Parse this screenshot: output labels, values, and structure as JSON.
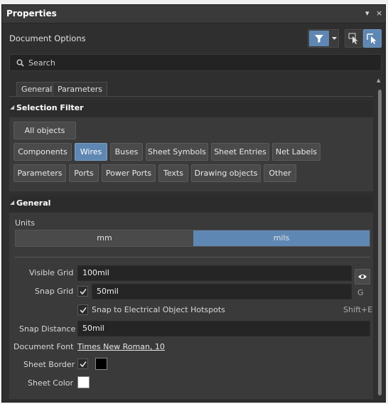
{
  "panel": {
    "title": "Properties",
    "pin_label": "▾",
    "close_label": "×",
    "document_options": "Document Options"
  },
  "search": {
    "placeholder": "Search"
  },
  "tabs": [
    {
      "label": "General",
      "active": true
    },
    {
      "label": "Parameters",
      "active": false
    }
  ],
  "selection_filter": {
    "heading": "Selection Filter",
    "all_objects": "All objects",
    "buttons": [
      {
        "label": "Components",
        "on": false
      },
      {
        "label": "Wires",
        "on": true
      },
      {
        "label": "Buses",
        "on": false
      },
      {
        "label": "Sheet Symbols",
        "on": false
      },
      {
        "label": "Sheet Entries",
        "on": false
      },
      {
        "label": "Net Labels",
        "on": false
      },
      {
        "label": "Parameters",
        "on": false
      },
      {
        "label": "Ports",
        "on": false
      },
      {
        "label": "Power Ports",
        "on": false
      },
      {
        "label": "Texts",
        "on": false
      },
      {
        "label": "Drawing objects",
        "on": false
      },
      {
        "label": "Other",
        "on": false
      }
    ]
  },
  "general": {
    "heading": "General",
    "units_label": "Units",
    "units": [
      "mm",
      "mils"
    ],
    "selected_unit": "mils",
    "visible_grid_label": "Visible Grid",
    "visible_grid_value": "100mil",
    "snap_grid_label": "Snap Grid",
    "snap_grid_value": "50mil",
    "snap_grid_shortcut": "G",
    "snap_hotspots_label": "Snap to Electrical Object Hotspots",
    "snap_hotspots_shortcut": "Shift+E",
    "snap_distance_label": "Snap Distance",
    "snap_distance_value": "50mil",
    "document_font_label": "Document Font",
    "document_font_value": "Times New Roman, 10",
    "sheet_border_label": "Sheet Border",
    "sheet_color_label": "Sheet Color"
  },
  "colors": {
    "accent": "#5f87b3",
    "sheet_border_color": "#000000",
    "sheet_color": "#ffffff"
  }
}
